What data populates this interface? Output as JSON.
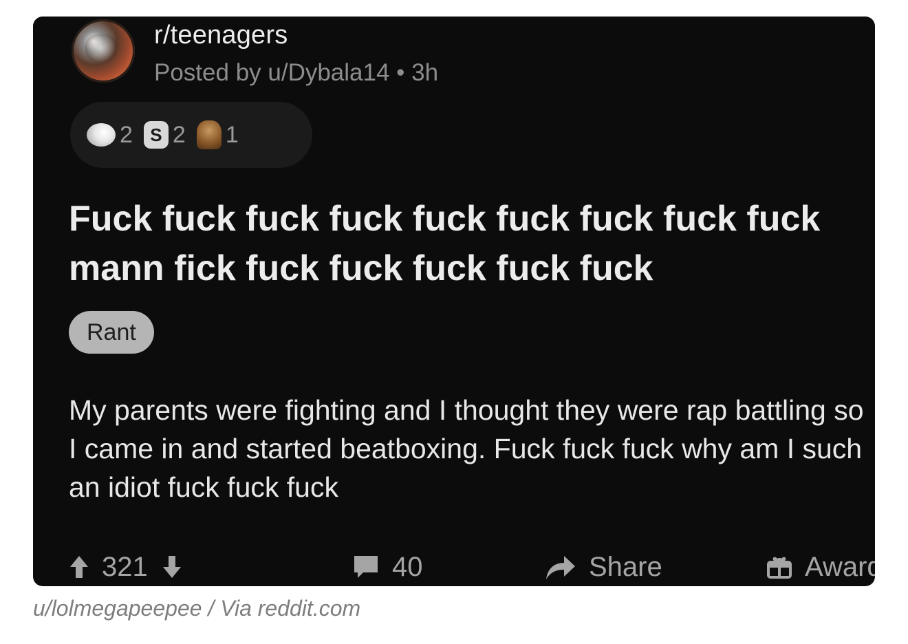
{
  "post": {
    "subreddit": "r/teenagers",
    "posted_by": "Posted by u/Dybala14 • 3h",
    "awards": [
      {
        "icon": "wholesome-award-icon",
        "count": "2"
      },
      {
        "icon": "silver-award-icon",
        "count": "2"
      },
      {
        "icon": "bronze-award-icon",
        "count": "1"
      }
    ],
    "title": "Fuck fuck fuck fuck fuck fuck fuck fuck fuck mann fick fuck fuck fuck fuck fuck",
    "flair": "Rant",
    "body": "My parents were fighting and I thought they were rap battling so I  came in and started beatboxing. Fuck fuck fuck why am I such an idiot fuck fuck fuck",
    "actions": {
      "votes": "321",
      "comments": "40",
      "share": "Share",
      "award": "Award"
    }
  },
  "caption": "u/lolmegapeepee / Via reddit.com",
  "colors": {
    "card_background": "#0c0c0c",
    "flair_background": "#b5b5b5",
    "muted_text": "#8d8d8d"
  }
}
